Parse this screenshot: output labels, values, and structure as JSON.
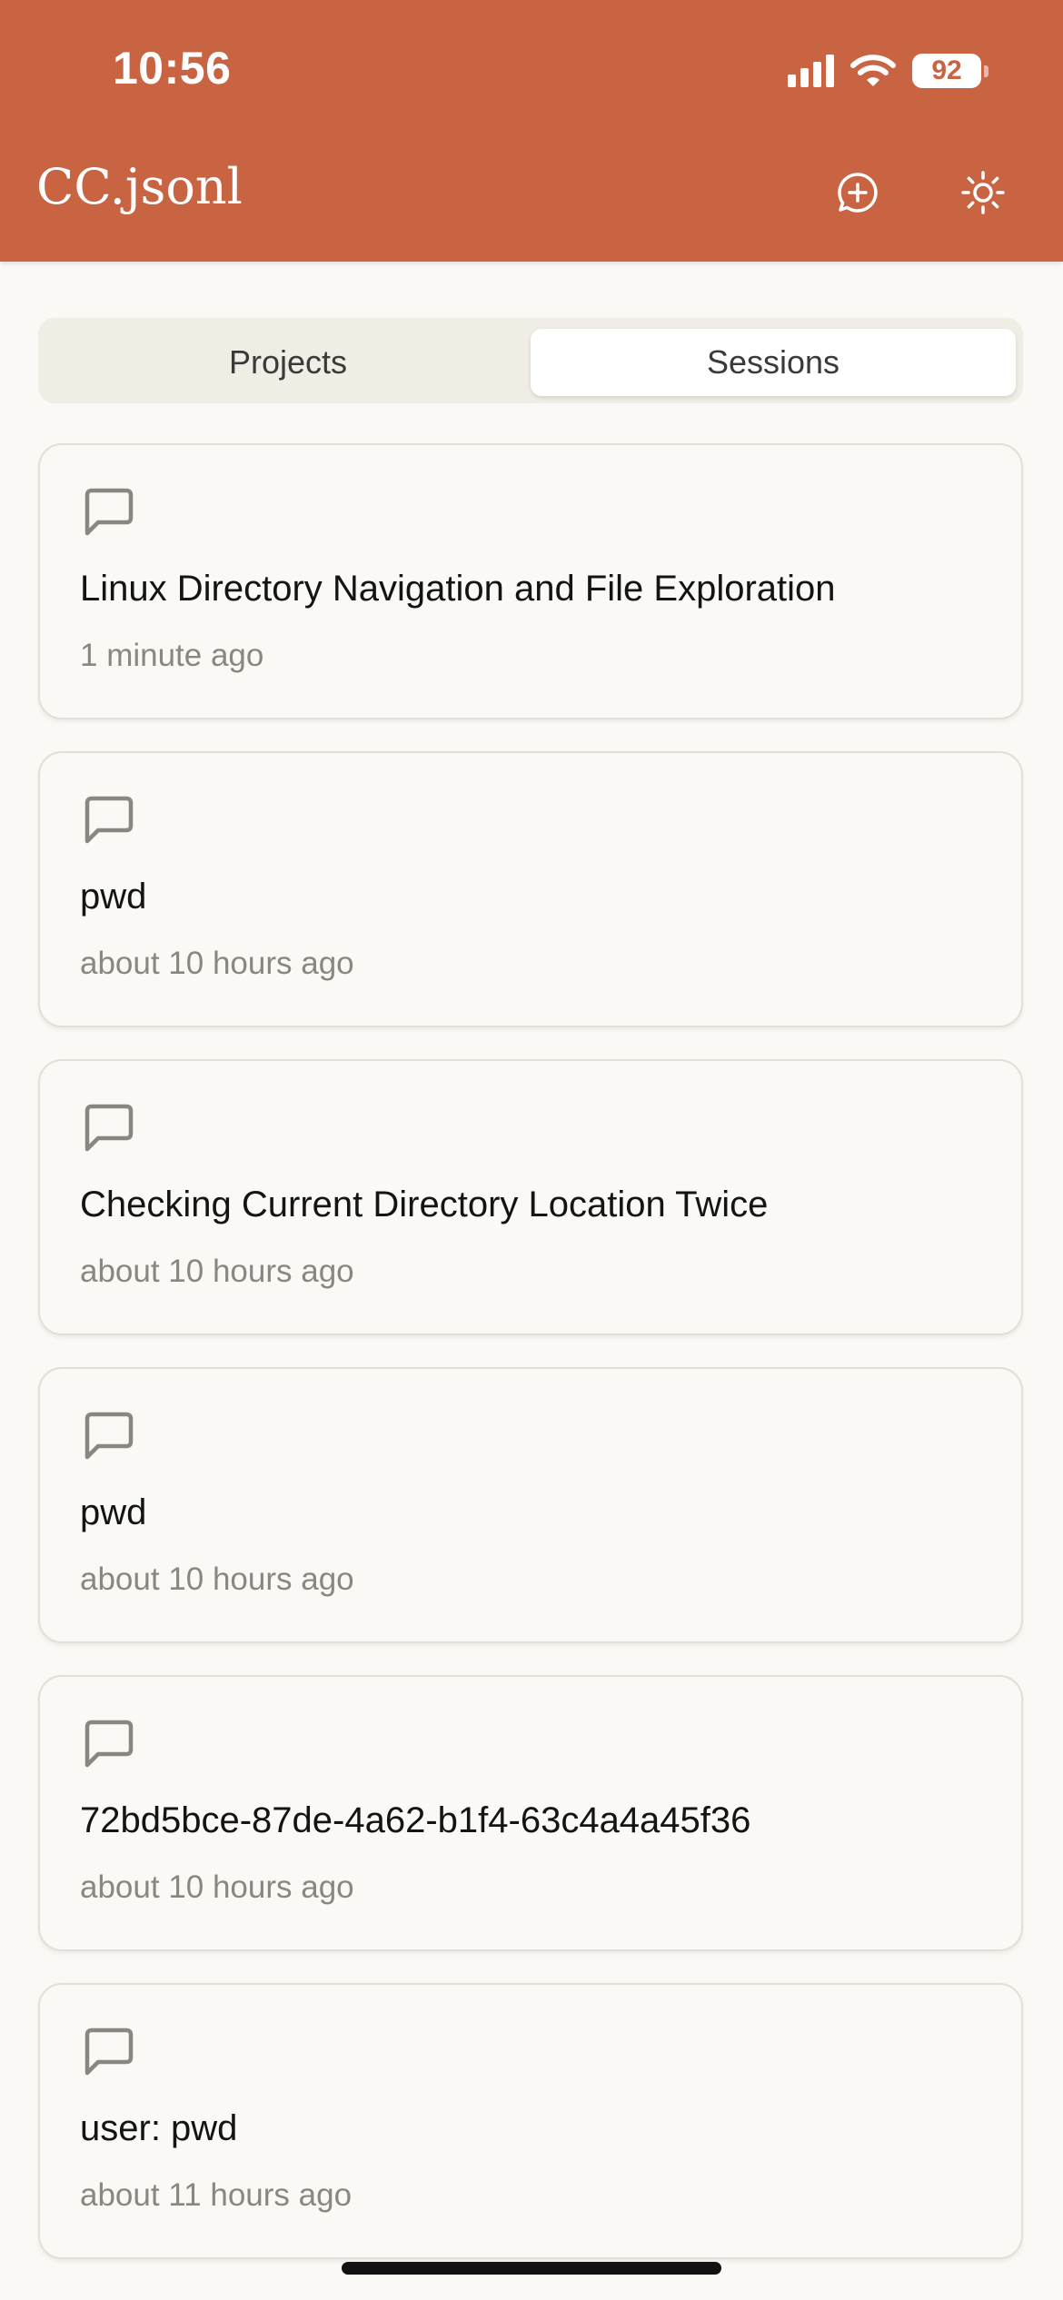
{
  "status_bar": {
    "time": "10:56",
    "battery": "92"
  },
  "header": {
    "title": "CC.jsonl",
    "icons": [
      "new-chat-icon",
      "sun-icon"
    ]
  },
  "tabs": [
    {
      "label": "Projects",
      "selected": false
    },
    {
      "label": "Sessions",
      "selected": true
    }
  ],
  "sessions": [
    {
      "title": "Linux Directory Navigation and File Exploration",
      "time": "1 minute ago"
    },
    {
      "title": "pwd",
      "time": "about 10 hours ago"
    },
    {
      "title": "Checking Current Directory Location Twice",
      "time": "about 10 hours ago"
    },
    {
      "title": "pwd",
      "time": "about 10 hours ago"
    },
    {
      "title": "72bd5bce-87de-4a62-b1f4-63c4a4a45f36",
      "time": "about 10 hours ago"
    },
    {
      "title": "user: pwd",
      "time": "about 11 hours ago"
    }
  ],
  "colors": {
    "header_bg": "#C96442",
    "page_bg": "#FAF9F6",
    "segment_bg": "#F0EDE4",
    "card_border": "#E3DFD7",
    "muted_text": "#8A8782"
  }
}
